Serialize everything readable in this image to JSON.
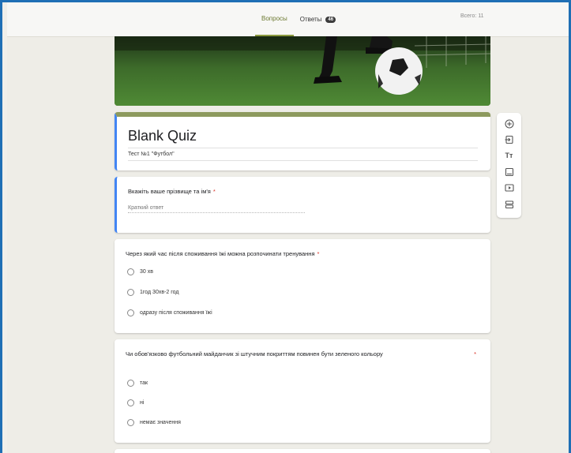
{
  "tabs": {
    "questions": "Вопросы",
    "answers": "Ответы",
    "answers_count": "46"
  },
  "total": {
    "label": "Всего:",
    "value": "11"
  },
  "form": {
    "title": "Blank Quiz",
    "description": "Тест №1 \"Футбол\""
  },
  "questions": [
    {
      "text": "Вкажіть ваше прізвище та ім'я",
      "required": "*",
      "placeholder": "Краткий ответ"
    },
    {
      "text": "Через який час після споживання їжі можна розпочинати тренування",
      "required": "*",
      "options": [
        "30 хв",
        "1год 30хв-2 год",
        "одразу після споживання їжі"
      ]
    },
    {
      "text": "Чи обов'язково футбольний майданчик зі штучним покриттям повинен бути зеленого кольору",
      "required": "*",
      "options": [
        "так",
        "ні",
        "немає значення"
      ]
    }
  ],
  "toolbar": [
    {
      "name": "add-question",
      "icon": "plus-circle-icon"
    },
    {
      "name": "import-questions",
      "icon": "import-icon"
    },
    {
      "name": "add-title",
      "icon": "text-tt-icon",
      "glyph": "Tт"
    },
    {
      "name": "add-image",
      "icon": "image-icon"
    },
    {
      "name": "add-video",
      "icon": "video-icon"
    },
    {
      "name": "add-section",
      "icon": "section-icon"
    }
  ],
  "colors": {
    "accent": "#8b9a3e",
    "focus": "#4285f4",
    "required": "#d93025",
    "frame": "#1f6fb5"
  }
}
